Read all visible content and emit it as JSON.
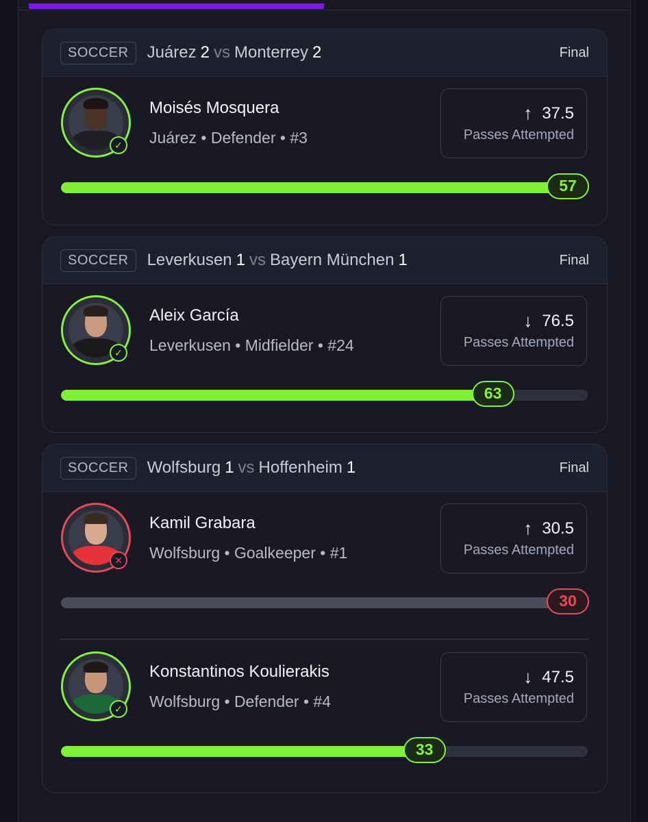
{
  "colors": {
    "accent_purple": "#7d17f0",
    "hit_green": "#7ef231",
    "miss_red": "#e84b57"
  },
  "stat_label": "Passes Attempted",
  "cards": [
    {
      "sport": "SOCCER",
      "home_team": "Juárez",
      "home_score": "2",
      "vs": "vs",
      "away_team": "Monterrey",
      "away_score": "2",
      "status": "Final",
      "players": [
        {
          "name": "Moisés Mosquera",
          "meta": "Juárez • Defender • #3",
          "direction": "up",
          "arrow": "↑",
          "line": "37.5",
          "result": "57",
          "progress": 1.0,
          "outcome": "hit",
          "mark": "✓",
          "skin": "#4a3226",
          "hair": "#1b1412",
          "shirt": "#1e1e24"
        }
      ]
    },
    {
      "sport": "SOCCER",
      "home_team": "Leverkusen",
      "home_score": "1",
      "vs": "vs",
      "away_team": "Bayern München",
      "away_score": "1",
      "status": "Final",
      "players": [
        {
          "name": "Aleix García",
          "meta": "Leverkusen • Midfielder • #24",
          "direction": "down",
          "arrow": "↓",
          "line": "76.5",
          "result": "63",
          "progress": 0.82,
          "outcome": "hit",
          "mark": "✓",
          "skin": "#c99c80",
          "hair": "#2a1f1a",
          "shirt": "#1a1a1c"
        }
      ]
    },
    {
      "sport": "SOCCER",
      "home_team": "Wolfsburg",
      "home_score": "1",
      "vs": "vs",
      "away_team": "Hoffenheim",
      "away_score": "1",
      "status": "Final",
      "players": [
        {
          "name": "Kamil Grabara",
          "meta": "Wolfsburg • Goalkeeper • #1",
          "direction": "up",
          "arrow": "↑",
          "line": "30.5",
          "result": "30",
          "progress": 0.98,
          "outcome": "miss",
          "mark": "✕",
          "skin": "#d7a98e",
          "hair": "#3a2a20",
          "shirt": "#e8323a"
        },
        {
          "name": "Konstantinos Koulierakis",
          "meta": "Wolfsburg • Defender • #4",
          "direction": "down",
          "arrow": "↓",
          "line": "47.5",
          "result": "33",
          "progress": 0.69,
          "outcome": "hit",
          "mark": "✓",
          "skin": "#c8977a",
          "hair": "#1f1a17",
          "shirt": "#1c6a3a"
        }
      ]
    }
  ]
}
